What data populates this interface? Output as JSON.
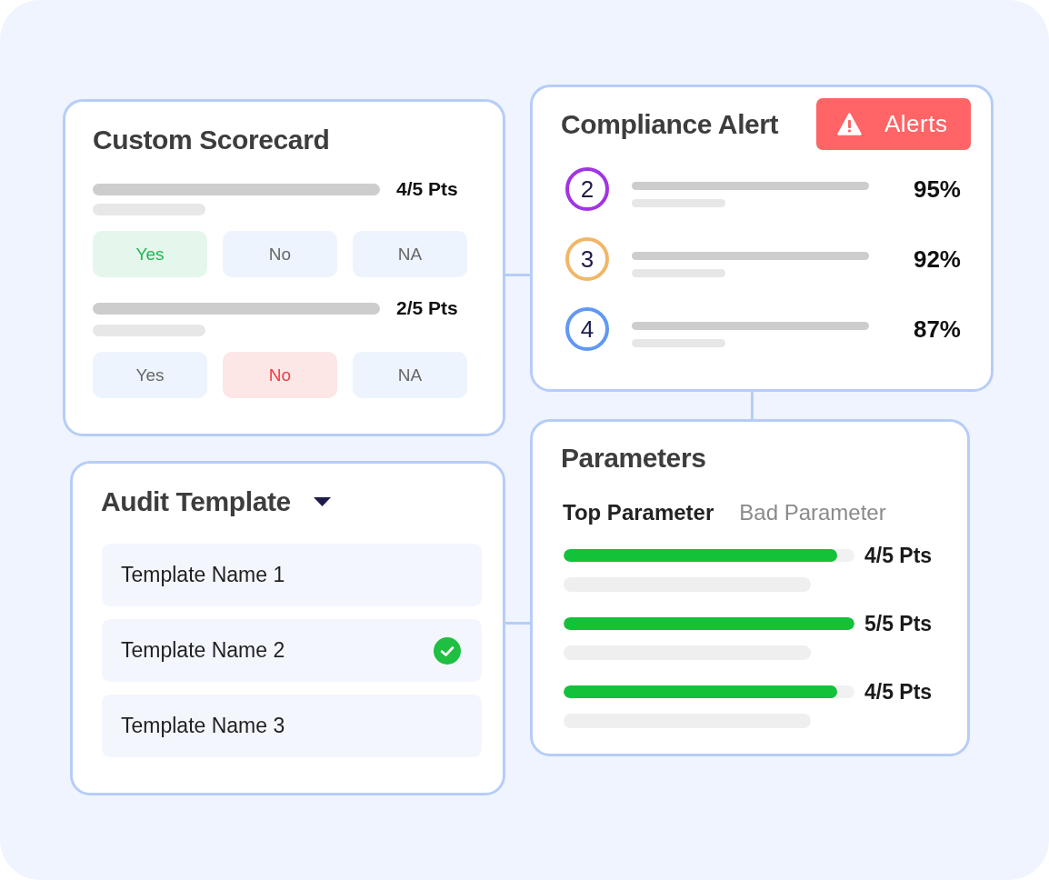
{
  "scorecard": {
    "title": "Custom Scorecard",
    "questions": [
      {
        "points": "4/5 Pts",
        "answers": [
          {
            "label": "Yes",
            "kind": "yes",
            "selected": true
          },
          {
            "label": "No",
            "kind": "no",
            "selected": false
          },
          {
            "label": "NA",
            "kind": "na",
            "selected": false
          }
        ]
      },
      {
        "points": "2/5 Pts",
        "answers": [
          {
            "label": "Yes",
            "kind": "yes",
            "selected": false
          },
          {
            "label": "No",
            "kind": "no",
            "selected": true
          },
          {
            "label": "NA",
            "kind": "na",
            "selected": false
          }
        ]
      }
    ]
  },
  "compliance_alert": {
    "title": "Compliance Alert",
    "alerts_button": {
      "label": "Alerts"
    },
    "items": [
      {
        "number": "2",
        "color": "#a035e3",
        "score": "95%"
      },
      {
        "number": "3",
        "color": "#f1b767",
        "score": "92%"
      },
      {
        "number": "4",
        "color": "#6198f2",
        "score": "87%"
      }
    ]
  },
  "audit_template": {
    "title": "Audit Template",
    "templates": [
      {
        "name": "Template Name 1",
        "selected": false
      },
      {
        "name": "Template Name 2",
        "selected": true
      },
      {
        "name": "Template Name 3",
        "selected": false
      }
    ]
  },
  "parameters": {
    "title": "Parameters",
    "tabs": [
      {
        "label": "Top Parameter",
        "selected": true
      },
      {
        "label": "Bad Parameter",
        "selected": false
      }
    ],
    "rows": [
      {
        "level": 0.94,
        "points": "4/5 Pts"
      },
      {
        "level": 1,
        "points": "5/5 Pts"
      },
      {
        "level": 0.94,
        "points": "4/5 Pts"
      }
    ]
  }
}
